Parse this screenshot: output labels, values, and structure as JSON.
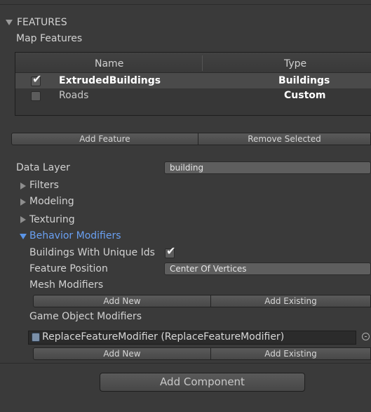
{
  "features": {
    "title": "FEATURES",
    "map_features_label": "Map Features",
    "table": {
      "columns": [
        "Name",
        "Type"
      ],
      "rows": [
        {
          "name": "ExtrudedBuildings",
          "type": "Buildings",
          "checked": true,
          "selected": true
        },
        {
          "name": "Roads",
          "type": "Custom",
          "checked": false,
          "selected": false
        }
      ]
    },
    "add_feature_label": "Add Feature",
    "remove_selected_label": "Remove Selected"
  },
  "properties": {
    "data_layer_label": "Data Layer",
    "data_layer_value": "building",
    "filters_label": "Filters",
    "modeling_label": "Modeling",
    "texturing_label": "Texturing",
    "behavior_modifiers_label": "Behavior Modifiers",
    "unique_ids_label": "Buildings With Unique Ids",
    "unique_ids_checked": true,
    "feature_position_label": "Feature Position",
    "feature_position_value": "Center Of Vertices",
    "mesh_modifiers_label": "Mesh Modifiers",
    "mesh_add_new": "Add New",
    "mesh_add_existing": "Add Existing",
    "game_object_modifiers_label": "Game Object Modifiers",
    "go_modifier_item": "ReplaceFeatureModifier (ReplaceFeatureModifier)",
    "go_add_new": "Add New",
    "go_add_existing": "Add Existing"
  },
  "footer": {
    "add_component_label": "Add Component"
  },
  "colors": {
    "background": "#3a3a3a",
    "accent_blue": "#6aa0f2",
    "selected_row": "#4a4a4a"
  }
}
